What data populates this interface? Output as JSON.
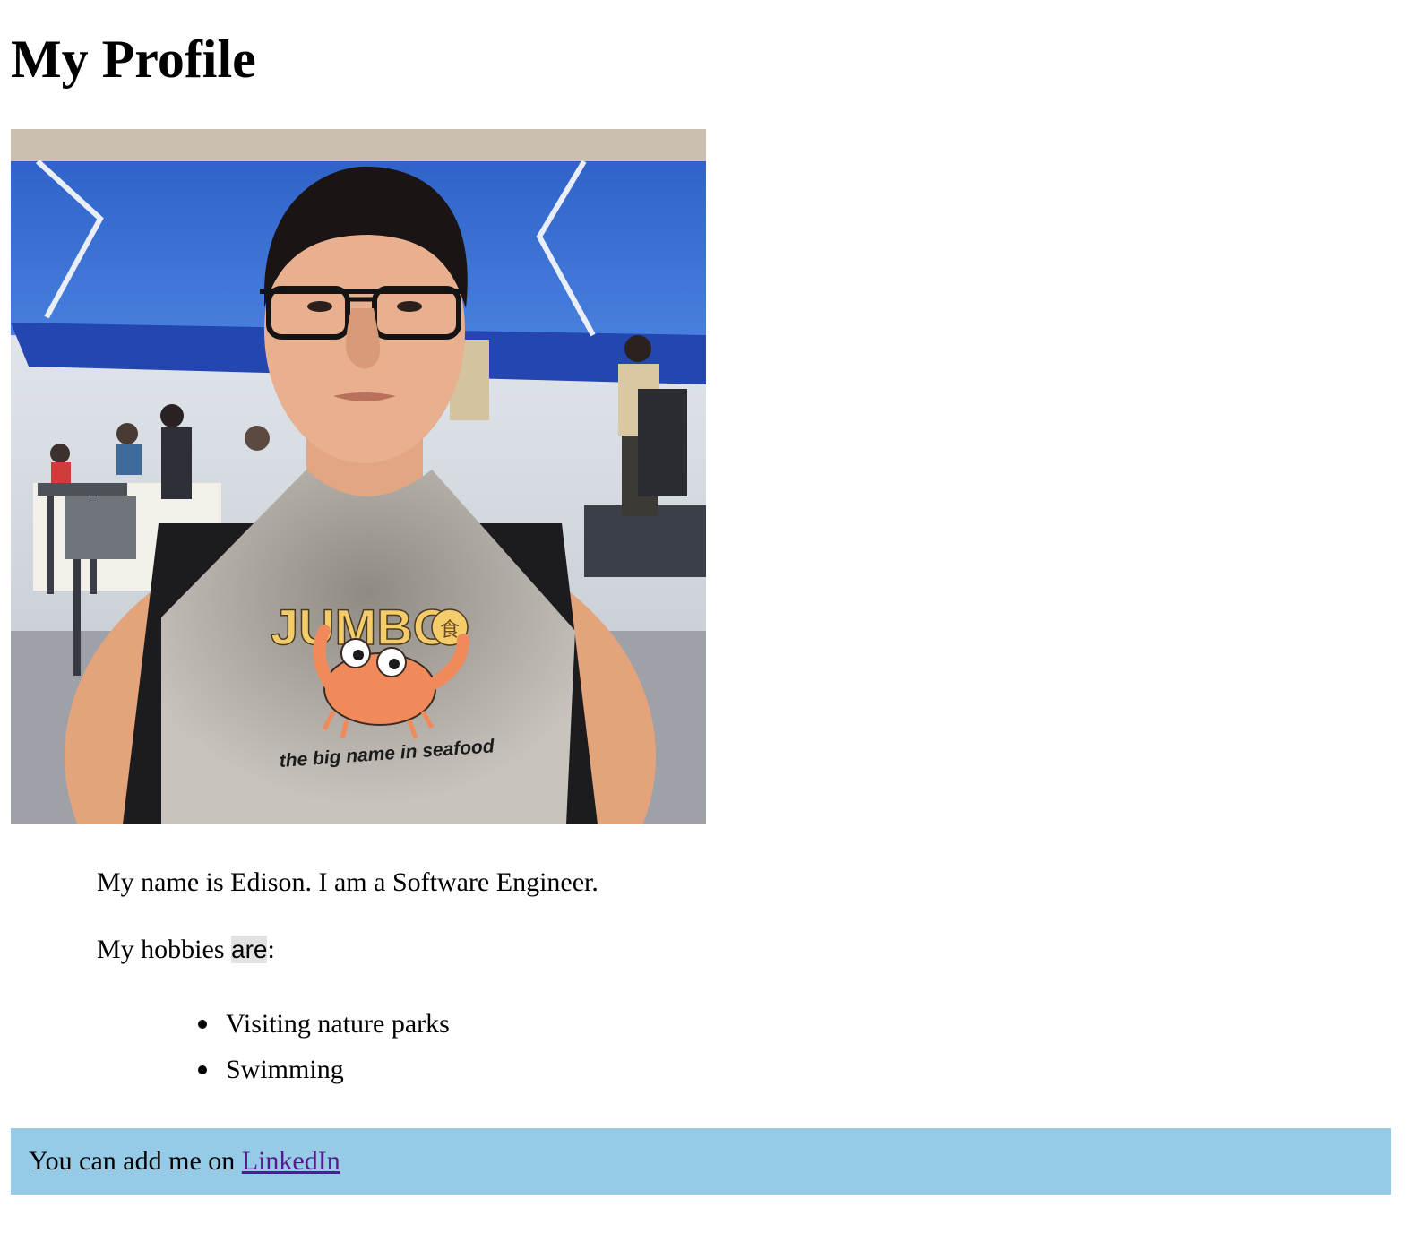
{
  "page": {
    "title": "My Profile"
  },
  "profile_photo": {
    "bib_logo_text": "JUMBO",
    "bib_tagline": "the big name in seafood",
    "bib_logo_mark": "食"
  },
  "bio": {
    "intro": "My name is Edison. I am a Software Engineer.",
    "hobbies_prefix": "My hobbies ",
    "hobbies_highlight": "are",
    "hobbies_suffix": ":"
  },
  "hobbies": [
    "Visiting nature parks",
    "Swimming"
  ],
  "footer": {
    "text": "You can add me on ",
    "link_label": "LinkedIn",
    "background": "#96cbe7",
    "link_color": "#551a8b"
  }
}
